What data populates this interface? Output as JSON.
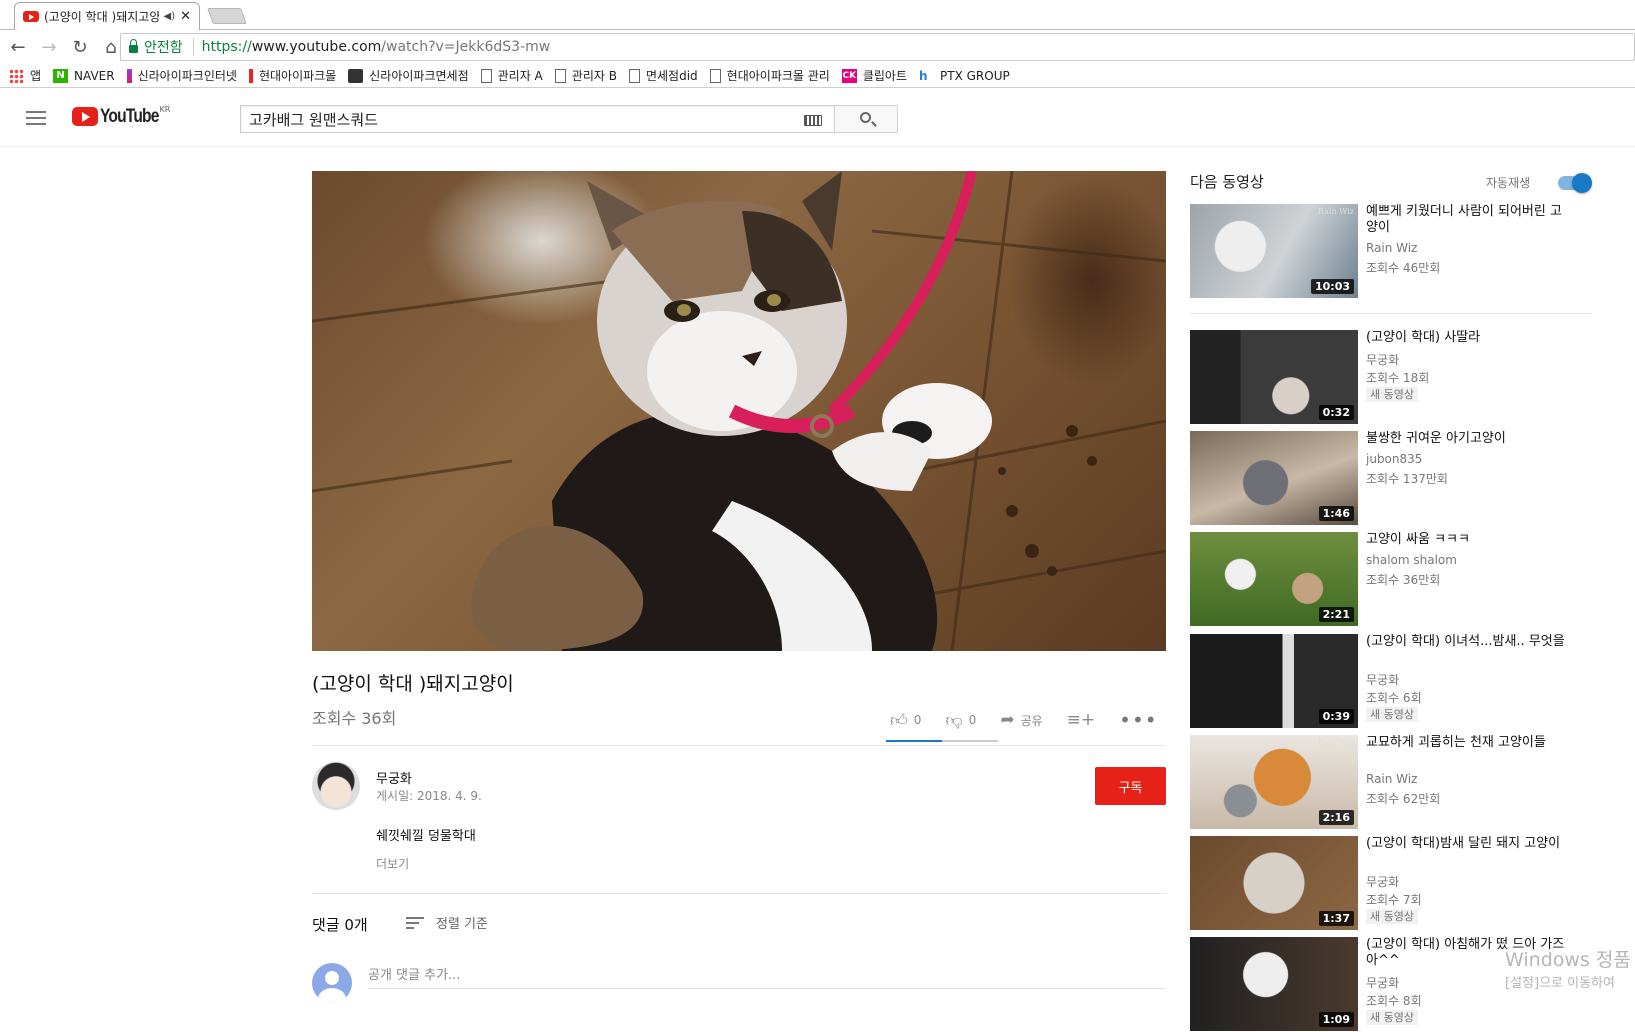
{
  "browser": {
    "tab_title": "(고양이 학대 )돼지고양",
    "url_scheme": "https://",
    "url_host": "www.youtube.com",
    "url_rest": "/watch?v=Jekk6dS3-mw",
    "secure_label": "안전함",
    "bookmarks": [
      "앱",
      "NAVER",
      "신라아이파크인터넷",
      "현대아이파크몰",
      "신라아이파크면세점",
      "관리자 A",
      "관리자 B",
      "면세점did",
      "현대아이파크몰 관리",
      "클립아트",
      "PTX GROUP"
    ]
  },
  "masthead": {
    "logo_text": "YouTube",
    "logo_region": "KR",
    "search_value": "고카배그 원맨스쿼드"
  },
  "video": {
    "title": "(고양이 학대 )돼지고양이",
    "views": "조회수 36회",
    "likes": "0",
    "dislikes": "0",
    "share_label": "공유",
    "like_ratio": 0.5
  },
  "owner": {
    "name": "무궁화",
    "published": "게시일: 2018. 4. 9.",
    "subscribe_label": "구독",
    "description": "쉐낏쉐낄 덩물학대",
    "show_more": "더보기"
  },
  "comments": {
    "count_label": "댓글 0개",
    "sort_label": "정렬 기준",
    "placeholder": "공개 댓글 추가..."
  },
  "sidebar": {
    "up_next": "다음 동영상",
    "autoplay": "자동재생",
    "autoplay_on": true,
    "videos": [
      {
        "title": "예쁘게 키웠더니 사람이 되어버린 고양이",
        "channel": "Rain Wiz",
        "views": "조회수 46만회",
        "duration": "10:03",
        "badge": "",
        "watermark": "Rain Wiz"
      },
      {
        "title": "(고양이 학대) 사딸라",
        "channel": "무궁화",
        "views": "조회수 18회",
        "duration": "0:32",
        "badge": "새 동영상",
        "watermark": ""
      },
      {
        "title": "불쌍한 귀여운 아기고양이",
        "channel": "jubon835",
        "views": "조회수 137만회",
        "duration": "1:46",
        "badge": "",
        "watermark": ""
      },
      {
        "title": "고양이 싸움 ㅋㅋㅋ",
        "channel": "shalom shalom",
        "views": "조회수 36만회",
        "duration": "2:21",
        "badge": "",
        "watermark": ""
      },
      {
        "title": "(고양이 학대) 이녀석...밤새.. 무엇을",
        "channel": "무궁화",
        "views": "조회수 6회",
        "duration": "0:39",
        "badge": "새 동영상",
        "watermark": ""
      },
      {
        "title": "교묘하게 괴롭히는 천재 고양이들",
        "channel": "Rain Wiz",
        "views": "조회수 62만회",
        "duration": "2:16",
        "badge": "",
        "watermark": "Rain Wiz"
      },
      {
        "title": "(고양이 학대)밤새 달린 돼지 고양이",
        "channel": "무궁화",
        "views": "조회수 7회",
        "duration": "1:37",
        "badge": "새 동영상",
        "watermark": ""
      },
      {
        "title": "(고양이 학대) 아침해가 떴 드아 가즈아^^",
        "channel": "무궁화",
        "views": "조회수 8회",
        "duration": "1:09",
        "badge": "새 동영상",
        "watermark": ""
      }
    ]
  },
  "os_watermark": {
    "line1": "Windows 정품",
    "line2": "[설정]으로 이동하여"
  }
}
